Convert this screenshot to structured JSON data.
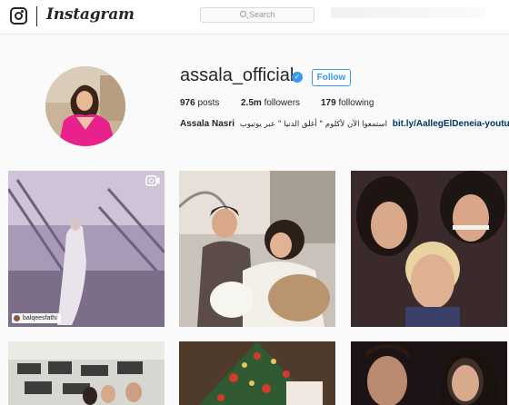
{
  "header": {
    "wordmark": "Instagram",
    "search_placeholder": "Search",
    "icons": [
      "instagram-glyph-icon",
      "search-icon"
    ]
  },
  "profile": {
    "username": "assala_official",
    "verified": true,
    "follow_label": "Follow",
    "stats": {
      "posts_count": "976",
      "posts_label": "posts",
      "followers_count": "2.5m",
      "followers_label": "followers",
      "following_count": "179",
      "following_label": "following"
    },
    "bio": {
      "name": "Assala Nasri",
      "text": "استمعوا الآن لأكلوم \" أغلق الدنيا \" عبر يوتيوب",
      "link": "bit.ly/AallegElDeneia-youtube"
    }
  },
  "posts": [
    {
      "id": "post-1",
      "type": "video",
      "tag": "balqeesfathi"
    },
    {
      "id": "post-2",
      "type": "image"
    },
    {
      "id": "post-3",
      "type": "image"
    },
    {
      "id": "post-4",
      "type": "image"
    },
    {
      "id": "post-5",
      "type": "image"
    },
    {
      "id": "post-6",
      "type": "image"
    }
  ],
  "colors": {
    "accent": "#3897f0",
    "link": "#003569",
    "text": "#262626",
    "background": "#fafafa"
  }
}
